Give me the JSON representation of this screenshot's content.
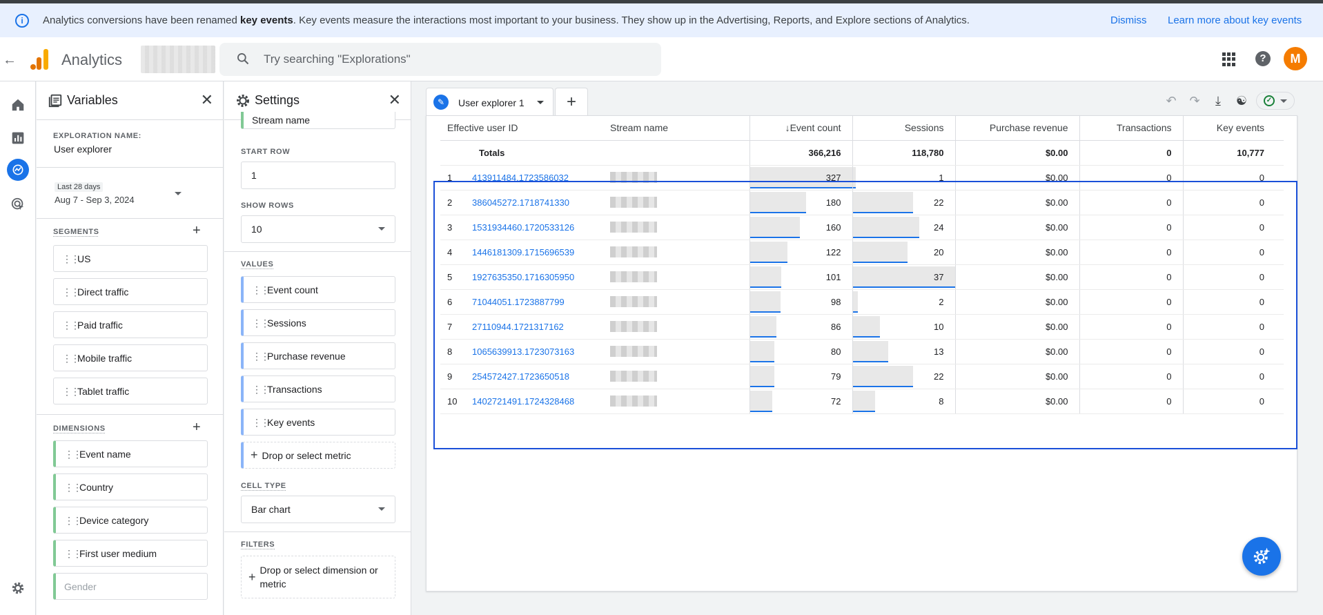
{
  "banner": {
    "pre": "Analytics conversions have been renamed ",
    "bold": "key events",
    "post": ". Key events measure the interactions most important to your business. They show up in the Advertising, Reports, and Explore sections of Analytics.",
    "dismiss": "Dismiss",
    "learn_more": "Learn more about key events"
  },
  "header": {
    "app_name": "Analytics",
    "search_placeholder": "Try searching \"Explorations\"",
    "avatar_letter": "M"
  },
  "colors": {
    "accent": "#1a73e8",
    "dimension": "#81c995",
    "metric": "#8ab4f8",
    "logo_orange": "#f9ab00",
    "logo_dark": "#e37400"
  },
  "variables": {
    "title": "Variables",
    "exploration_label": "EXPLORATION NAME:",
    "exploration_name": "User explorer",
    "date_range_label": "Last 28 days",
    "date_range": "Aug 7 - Sep 3, 2024",
    "segments_label": "SEGMENTS",
    "segments": [
      "US",
      "Direct traffic",
      "Paid traffic",
      "Mobile traffic",
      "Tablet traffic"
    ],
    "dimensions_label": "DIMENSIONS",
    "dimensions": [
      "Event name",
      "Country",
      "Device category",
      "First user medium"
    ],
    "dimension_placeholder": "Gender"
  },
  "settings": {
    "title": "Settings",
    "top_chip": "Stream name",
    "start_row_label": "START ROW",
    "start_row": "1",
    "show_rows_label": "SHOW ROWS",
    "show_rows": "10",
    "values_label": "VALUES",
    "values": [
      "Event count",
      "Sessions",
      "Purchase revenue",
      "Transactions",
      "Key events"
    ],
    "drop_metric": "Drop or select metric",
    "cell_type_label": "CELL TYPE",
    "cell_type": "Bar chart",
    "filters_label": "FILTERS",
    "drop_filter": "Drop or select dimension or metric"
  },
  "tab": {
    "label": "User explorer 1"
  },
  "table": {
    "columns": [
      "Effective user ID",
      "Stream name",
      "Event count",
      "Sessions",
      "Purchase revenue",
      "Transactions",
      "Key events"
    ],
    "sort_column": "Event count",
    "totals_label": "Totals",
    "totals": [
      "366,216",
      "118,780",
      "$0.00",
      "0",
      "10,777"
    ],
    "rows": [
      {
        "n": "1",
        "id": "413911484.1723586032",
        "events": "327",
        "event_frac": 1.0,
        "sessions": "1",
        "sess_frac": 0.03,
        "revenue": "$0.00",
        "tx": "0",
        "key": "0"
      },
      {
        "n": "2",
        "id": "386045272.1718741330",
        "events": "180",
        "event_frac": 0.55,
        "sessions": "22",
        "sess_frac": 0.59,
        "revenue": "$0.00",
        "tx": "0",
        "key": "0"
      },
      {
        "n": "3",
        "id": "1531934460.1720533126",
        "events": "160",
        "event_frac": 0.49,
        "sessions": "24",
        "sess_frac": 0.65,
        "revenue": "$0.00",
        "tx": "0",
        "key": "0"
      },
      {
        "n": "4",
        "id": "1446181309.1715696539",
        "events": "122",
        "event_frac": 0.37,
        "sessions": "20",
        "sess_frac": 0.54,
        "revenue": "$0.00",
        "tx": "0",
        "key": "0"
      },
      {
        "n": "5",
        "id": "1927635350.1716305950",
        "events": "101",
        "event_frac": 0.31,
        "sessions": "37",
        "sess_frac": 1.0,
        "revenue": "$0.00",
        "tx": "0",
        "key": "0"
      },
      {
        "n": "6",
        "id": "71044051.1723887799",
        "events": "98",
        "event_frac": 0.3,
        "sessions": "2",
        "sess_frac": 0.05,
        "revenue": "$0.00",
        "tx": "0",
        "key": "0"
      },
      {
        "n": "7",
        "id": "27110944.1721317162",
        "events": "86",
        "event_frac": 0.26,
        "sessions": "10",
        "sess_frac": 0.27,
        "revenue": "$0.00",
        "tx": "0",
        "key": "0"
      },
      {
        "n": "8",
        "id": "1065639913.1723073163",
        "events": "80",
        "event_frac": 0.24,
        "sessions": "13",
        "sess_frac": 0.35,
        "revenue": "$0.00",
        "tx": "0",
        "key": "0"
      },
      {
        "n": "9",
        "id": "254572427.1723650518",
        "events": "79",
        "event_frac": 0.24,
        "sessions": "22",
        "sess_frac": 0.59,
        "revenue": "$0.00",
        "tx": "0",
        "key": "0"
      },
      {
        "n": "10",
        "id": "1402721491.1724328468",
        "events": "72",
        "event_frac": 0.22,
        "sessions": "8",
        "sess_frac": 0.22,
        "revenue": "$0.00",
        "tx": "0",
        "key": "0"
      }
    ]
  }
}
